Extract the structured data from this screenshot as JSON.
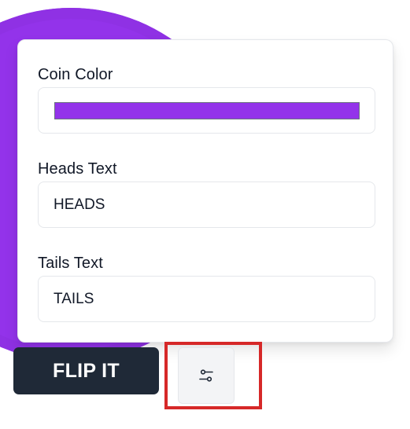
{
  "settings_panel": {
    "coin_color": {
      "label": "Coin Color",
      "value": "#9333ea"
    },
    "heads_text": {
      "label": "Heads Text",
      "value": "HEADS"
    },
    "tails_text": {
      "label": "Tails Text",
      "value": "TAILS"
    }
  },
  "actions": {
    "flip_label": "FLIP IT",
    "settings_toggle_icon": "sliders-icon"
  },
  "colors": {
    "coin": "#9333ea",
    "flip_button": "#1f2937",
    "highlight_frame": "#d62828"
  }
}
